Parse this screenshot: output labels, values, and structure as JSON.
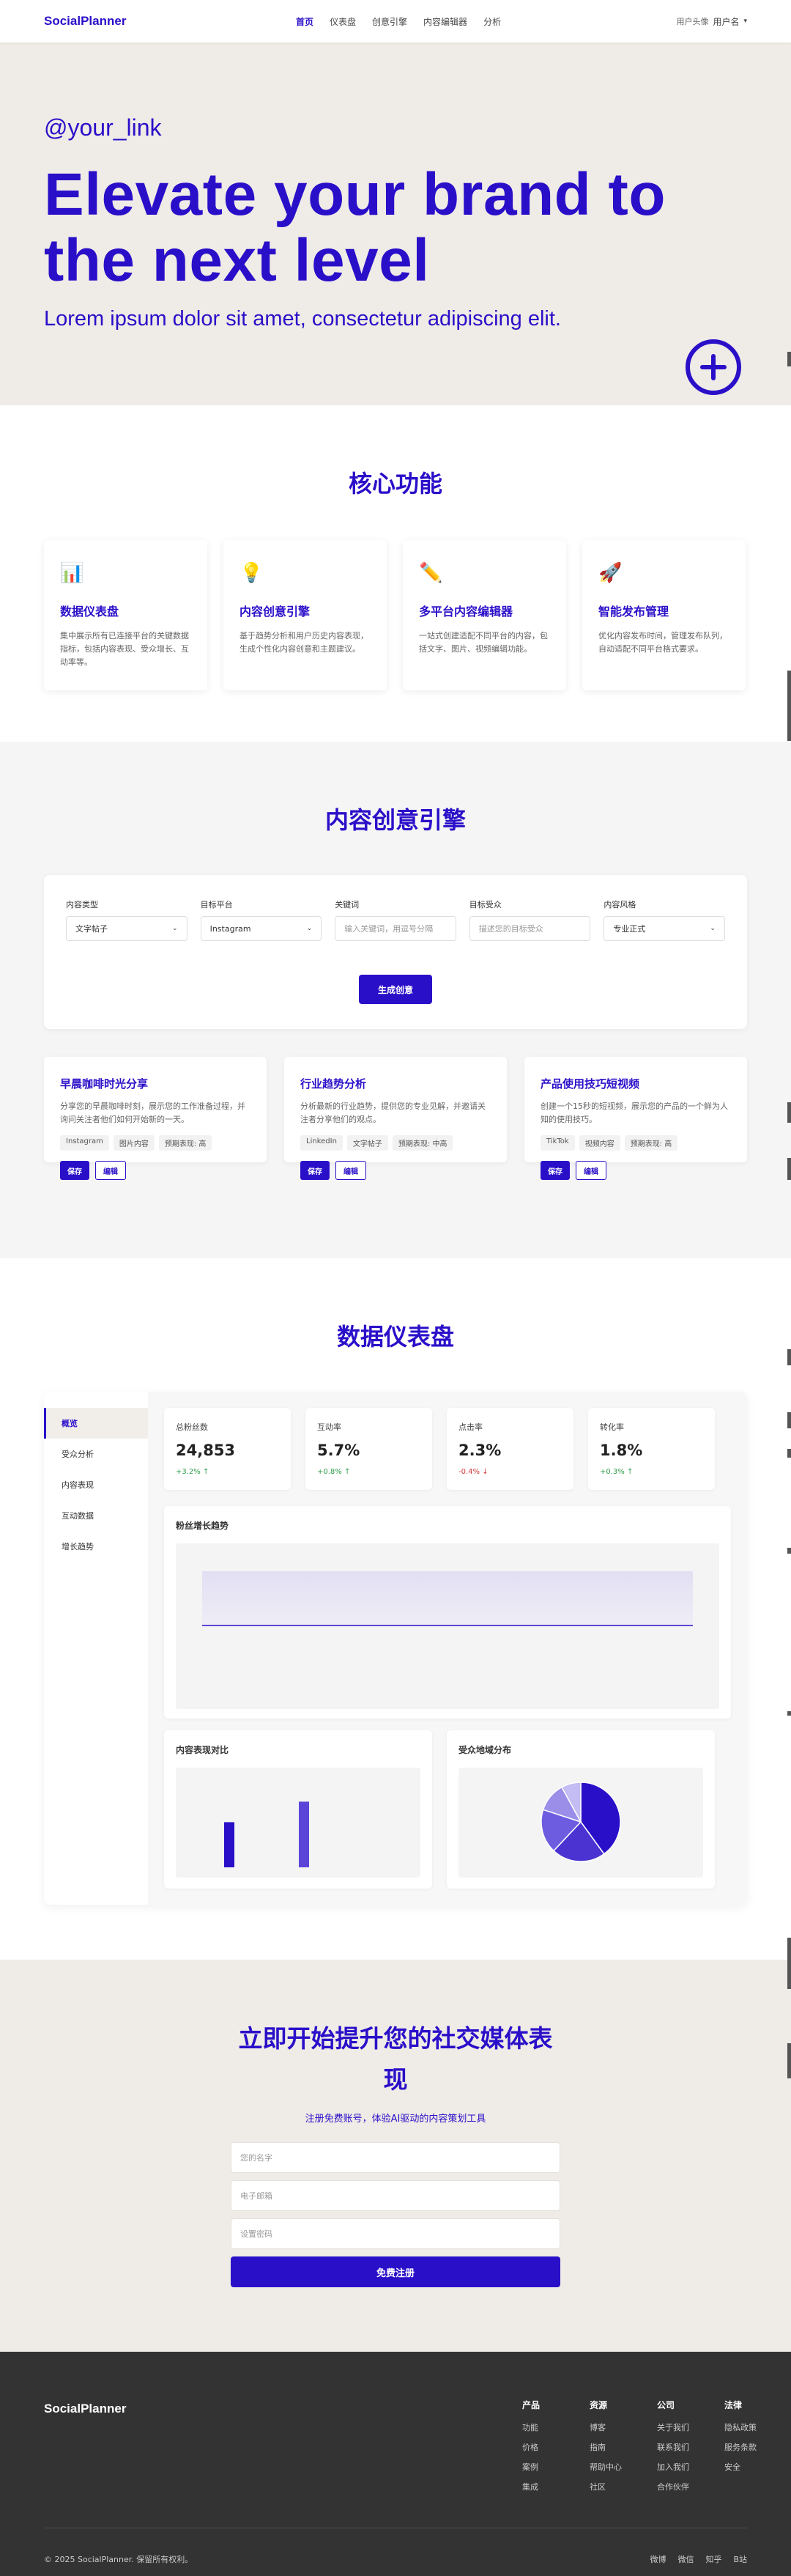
{
  "nav": {
    "logo": "SocialPlanner",
    "links": [
      "首页",
      "仪表盘",
      "创意引擎",
      "内容编辑器",
      "分析"
    ],
    "avatar_alt": "用户头像",
    "username": "用户名",
    "caret": "▾"
  },
  "hero": {
    "handle": "@your_link",
    "title": "Elevate your brand to the next level",
    "subtitle": "Lorem ipsum dolor sit amet, consectetur adipiscing elit."
  },
  "features": {
    "title": "核心功能",
    "cards": [
      {
        "icon": "📊",
        "title": "数据仪表盘",
        "desc": "集中展示所有已连接平台的关键数据指标，包括内容表现、受众增长、互动率等。"
      },
      {
        "icon": "💡",
        "title": "内容创意引擎",
        "desc": "基于趋势分析和用户历史内容表现，生成个性化内容创意和主题建议。"
      },
      {
        "icon": "✏️",
        "title": "多平台内容编辑器",
        "desc": "一站式创建适配不同平台的内容，包括文字、图片、视频编辑功能。"
      },
      {
        "icon": "🚀",
        "title": "智能发布管理",
        "desc": "优化内容发布时间，管理发布队列，自动适配不同平台格式要求。"
      }
    ]
  },
  "engine": {
    "title": "内容创意引擎",
    "fields": [
      {
        "label": "内容类型",
        "value": "文字帖子",
        "type": "select"
      },
      {
        "label": "目标平台",
        "value": "Instagram",
        "type": "select"
      },
      {
        "label": "关键词",
        "placeholder": "输入关键词，用逗号分隔",
        "type": "input"
      },
      {
        "label": "目标受众",
        "placeholder": "描述您的目标受众",
        "type": "input"
      },
      {
        "label": "内容风格",
        "value": "专业正式",
        "type": "select"
      }
    ],
    "generate_label": "生成创意",
    "ideas": [
      {
        "title": "早晨咖啡时光分享",
        "desc": "分享您的早晨咖啡时刻，展示您的工作准备过程，并询问关注者他们如何开始新的一天。",
        "tags": [
          "Instagram",
          "图片内容",
          "预期表现: 高"
        ]
      },
      {
        "title": "行业趋势分析",
        "desc": "分析最新的行业趋势，提供您的专业见解，并邀请关注者分享他们的观点。",
        "tags": [
          "LinkedIn",
          "文字帖子",
          "预期表现: 中高"
        ]
      },
      {
        "title": "产品使用技巧短视频",
        "desc": "创建一个15秒的短视频，展示您的产品的一个鲜为人知的使用技巧。",
        "tags": [
          "TikTok",
          "视频内容",
          "预期表现: 高"
        ]
      }
    ],
    "save_label": "保存",
    "edit_label": "编辑"
  },
  "dashboard": {
    "title": "数据仪表盘",
    "sidebar": [
      "概览",
      "受众分析",
      "内容表现",
      "互动数据",
      "增长趋势"
    ],
    "stats": [
      {
        "label": "总粉丝数",
        "value": "24,853",
        "change": "+3.2% ↑",
        "dir": "up"
      },
      {
        "label": "互动率",
        "value": "5.7%",
        "change": "+0.8% ↑",
        "dir": "up"
      },
      {
        "label": "点击率",
        "value": "2.3%",
        "change": "-0.4% ↓",
        "dir": "down"
      },
      {
        "label": "转化率",
        "value": "1.8%",
        "change": "+0.3% ↑",
        "dir": "up"
      }
    ],
    "growth_title": "粉丝增长趋势",
    "content_title": "内容表现对比",
    "geo_title": "受众地域分布"
  },
  "chart_data": [
    {
      "type": "area",
      "series": [
        {
          "values": [
            0.3,
            0.3,
            0.3,
            0.3,
            0.3,
            0.3,
            0.3
          ]
        }
      ]
    },
    {
      "type": "bar",
      "values": [
        0.55,
        0.8
      ]
    },
    {
      "type": "pie",
      "values": [
        40,
        22,
        18,
        12,
        8
      ]
    }
  ],
  "signup": {
    "title": "立即开始提升您的社交媒体表现",
    "subtitle": "注册免费账号，体验AI驱动的内容策划工具",
    "name_placeholder": "您的名字",
    "email_placeholder": "电子邮箱",
    "password_placeholder": "设置密码",
    "button": "免费注册"
  },
  "footer": {
    "logo": "SocialPlanner",
    "columns": [
      {
        "title": "产品",
        "links": [
          "功能",
          "价格",
          "案例",
          "集成"
        ]
      },
      {
        "title": "资源",
        "links": [
          "博客",
          "指南",
          "帮助中心",
          "社区"
        ]
      },
      {
        "title": "公司",
        "links": [
          "关于我们",
          "联系我们",
          "加入我们",
          "合作伙伴"
        ]
      },
      {
        "title": "法律",
        "links": [
          "隐私政策",
          "服务条款",
          "安全"
        ]
      }
    ],
    "copyright": "© 2025 SocialPlanner. 保留所有权利。",
    "social": [
      "微博",
      "微信",
      "知乎",
      "B站"
    ]
  },
  "colors": {
    "brand": "#2a0fc9",
    "beige": "#efebe6",
    "footer": "#333333"
  }
}
